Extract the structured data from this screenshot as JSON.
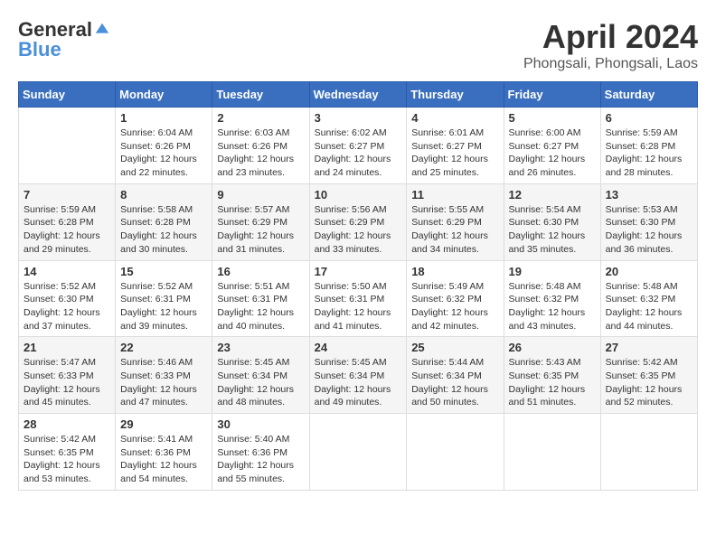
{
  "header": {
    "logo": {
      "general": "General",
      "blue": "Blue"
    },
    "title": "April 2024",
    "location": "Phongsali, Phongsali, Laos"
  },
  "calendar": {
    "days_of_week": [
      "Sunday",
      "Monday",
      "Tuesday",
      "Wednesday",
      "Thursday",
      "Friday",
      "Saturday"
    ],
    "weeks": [
      [
        {
          "day": "",
          "info": ""
        },
        {
          "day": "1",
          "info": "Sunrise: 6:04 AM\nSunset: 6:26 PM\nDaylight: 12 hours\nand 22 minutes."
        },
        {
          "day": "2",
          "info": "Sunrise: 6:03 AM\nSunset: 6:26 PM\nDaylight: 12 hours\nand 23 minutes."
        },
        {
          "day": "3",
          "info": "Sunrise: 6:02 AM\nSunset: 6:27 PM\nDaylight: 12 hours\nand 24 minutes."
        },
        {
          "day": "4",
          "info": "Sunrise: 6:01 AM\nSunset: 6:27 PM\nDaylight: 12 hours\nand 25 minutes."
        },
        {
          "day": "5",
          "info": "Sunrise: 6:00 AM\nSunset: 6:27 PM\nDaylight: 12 hours\nand 26 minutes."
        },
        {
          "day": "6",
          "info": "Sunrise: 5:59 AM\nSunset: 6:28 PM\nDaylight: 12 hours\nand 28 minutes."
        }
      ],
      [
        {
          "day": "7",
          "info": "Sunrise: 5:59 AM\nSunset: 6:28 PM\nDaylight: 12 hours\nand 29 minutes."
        },
        {
          "day": "8",
          "info": "Sunrise: 5:58 AM\nSunset: 6:28 PM\nDaylight: 12 hours\nand 30 minutes."
        },
        {
          "day": "9",
          "info": "Sunrise: 5:57 AM\nSunset: 6:29 PM\nDaylight: 12 hours\nand 31 minutes."
        },
        {
          "day": "10",
          "info": "Sunrise: 5:56 AM\nSunset: 6:29 PM\nDaylight: 12 hours\nand 33 minutes."
        },
        {
          "day": "11",
          "info": "Sunrise: 5:55 AM\nSunset: 6:29 PM\nDaylight: 12 hours\nand 34 minutes."
        },
        {
          "day": "12",
          "info": "Sunrise: 5:54 AM\nSunset: 6:30 PM\nDaylight: 12 hours\nand 35 minutes."
        },
        {
          "day": "13",
          "info": "Sunrise: 5:53 AM\nSunset: 6:30 PM\nDaylight: 12 hours\nand 36 minutes."
        }
      ],
      [
        {
          "day": "14",
          "info": "Sunrise: 5:52 AM\nSunset: 6:30 PM\nDaylight: 12 hours\nand 37 minutes."
        },
        {
          "day": "15",
          "info": "Sunrise: 5:52 AM\nSunset: 6:31 PM\nDaylight: 12 hours\nand 39 minutes."
        },
        {
          "day": "16",
          "info": "Sunrise: 5:51 AM\nSunset: 6:31 PM\nDaylight: 12 hours\nand 40 minutes."
        },
        {
          "day": "17",
          "info": "Sunrise: 5:50 AM\nSunset: 6:31 PM\nDaylight: 12 hours\nand 41 minutes."
        },
        {
          "day": "18",
          "info": "Sunrise: 5:49 AM\nSunset: 6:32 PM\nDaylight: 12 hours\nand 42 minutes."
        },
        {
          "day": "19",
          "info": "Sunrise: 5:48 AM\nSunset: 6:32 PM\nDaylight: 12 hours\nand 43 minutes."
        },
        {
          "day": "20",
          "info": "Sunrise: 5:48 AM\nSunset: 6:32 PM\nDaylight: 12 hours\nand 44 minutes."
        }
      ],
      [
        {
          "day": "21",
          "info": "Sunrise: 5:47 AM\nSunset: 6:33 PM\nDaylight: 12 hours\nand 45 minutes."
        },
        {
          "day": "22",
          "info": "Sunrise: 5:46 AM\nSunset: 6:33 PM\nDaylight: 12 hours\nand 47 minutes."
        },
        {
          "day": "23",
          "info": "Sunrise: 5:45 AM\nSunset: 6:34 PM\nDaylight: 12 hours\nand 48 minutes."
        },
        {
          "day": "24",
          "info": "Sunrise: 5:45 AM\nSunset: 6:34 PM\nDaylight: 12 hours\nand 49 minutes."
        },
        {
          "day": "25",
          "info": "Sunrise: 5:44 AM\nSunset: 6:34 PM\nDaylight: 12 hours\nand 50 minutes."
        },
        {
          "day": "26",
          "info": "Sunrise: 5:43 AM\nSunset: 6:35 PM\nDaylight: 12 hours\nand 51 minutes."
        },
        {
          "day": "27",
          "info": "Sunrise: 5:42 AM\nSunset: 6:35 PM\nDaylight: 12 hours\nand 52 minutes."
        }
      ],
      [
        {
          "day": "28",
          "info": "Sunrise: 5:42 AM\nSunset: 6:35 PM\nDaylight: 12 hours\nand 53 minutes."
        },
        {
          "day": "29",
          "info": "Sunrise: 5:41 AM\nSunset: 6:36 PM\nDaylight: 12 hours\nand 54 minutes."
        },
        {
          "day": "30",
          "info": "Sunrise: 5:40 AM\nSunset: 6:36 PM\nDaylight: 12 hours\nand 55 minutes."
        },
        {
          "day": "",
          "info": ""
        },
        {
          "day": "",
          "info": ""
        },
        {
          "day": "",
          "info": ""
        },
        {
          "day": "",
          "info": ""
        }
      ]
    ]
  }
}
